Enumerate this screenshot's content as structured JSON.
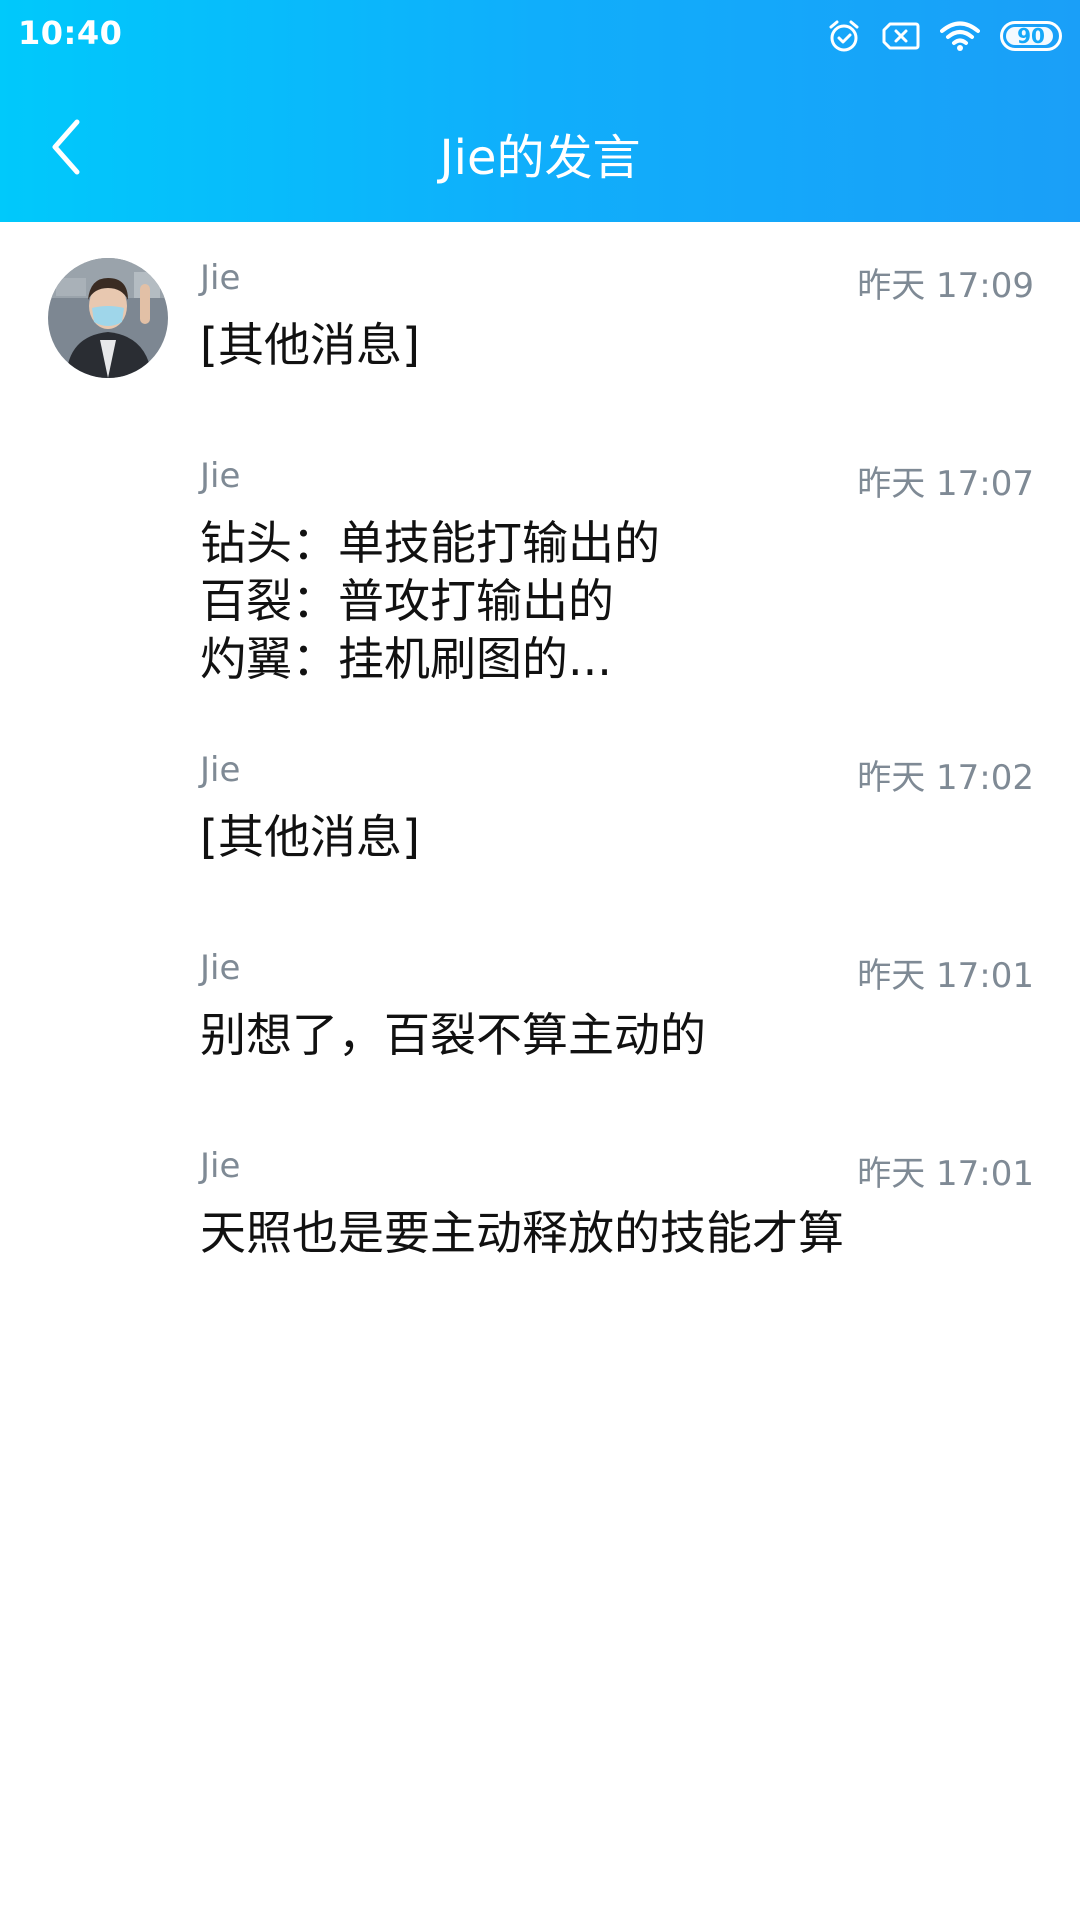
{
  "status_bar": {
    "time": "10:40",
    "icons": [
      "alarm-icon",
      "sim-none-icon",
      "wifi-icon",
      "battery-icon"
    ],
    "battery": "90"
  },
  "header": {
    "back_icon": "chevron-left-icon",
    "title": "Jie的发言"
  },
  "messages": [
    {
      "sender": "Jie",
      "time": "昨天 17:09",
      "lines": [
        "[其他消息]"
      ]
    },
    {
      "sender": "Jie",
      "time": "昨天 17:07",
      "lines": [
        "钻头：单技能打输出的",
        "百裂：普攻打输出的",
        "灼翼：挂机刷图的..."
      ]
    },
    {
      "sender": "Jie",
      "time": "昨天 17:02",
      "lines": [
        "[其他消息]"
      ]
    },
    {
      "sender": "Jie",
      "time": "昨天 17:01",
      "lines": [
        "别想了，百裂不算主动的"
      ]
    },
    {
      "sender": "Jie",
      "time": "昨天 17:01",
      "lines": [
        "天照也是要主动释放的技能才算"
      ]
    }
  ],
  "colors": {
    "header_gradient_start": "#00c9fb",
    "header_gradient_end": "#1a9ff8",
    "meta_text": "#7f8a95",
    "body_text": "#111111",
    "background": "#ffffff"
  }
}
